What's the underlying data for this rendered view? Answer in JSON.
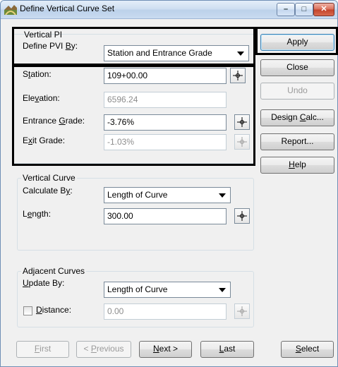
{
  "window": {
    "title": "Define Vertical Curve Set"
  },
  "vertical_pi": {
    "group_label": "Vertical PI",
    "define_by_label_pre": "Define PVI ",
    "define_by_label_ul": "B",
    "define_by_label_post": "y:",
    "define_by_value": "Station and Entrance Grade",
    "station_label_pre": "S",
    "station_label_ul": "t",
    "station_label_post": "ation:",
    "station_value": "109+00.00",
    "elevation_label_pre": "Ele",
    "elevation_label_ul": "v",
    "elevation_label_post": "ation:",
    "elevation_value": "6596.24",
    "entrance_label_pre": "Entrance ",
    "entrance_label_ul": "G",
    "entrance_label_post": "rade:",
    "entrance_value": "-3.76%",
    "exit_label_pre": "E",
    "exit_label_ul": "x",
    "exit_label_post": "it Grade:",
    "exit_value": "-1.03%"
  },
  "vertical_curve": {
    "group_label": "Vertical Curve",
    "calc_label_pre": "Calculate B",
    "calc_label_ul": "y",
    "calc_label_post": ":",
    "calc_value": "Length of Curve",
    "length_label_pre": "L",
    "length_label_ul": "e",
    "length_label_post": "ngth:",
    "length_value": "300.00"
  },
  "adjacent": {
    "group_label": "Adjacent Curves",
    "update_label_pre": "",
    "update_label_ul": "U",
    "update_label_post": "pdate By:",
    "update_value": "Length of Curve",
    "distance_label_pre": "",
    "distance_label_ul": "D",
    "distance_label_post": "istance:",
    "distance_value": "0.00"
  },
  "side_buttons": {
    "apply": "Apply",
    "close": "Close",
    "undo": "Undo",
    "design_pre": "Design ",
    "design_ul": "C",
    "design_post": "alc...",
    "report": "Report...",
    "help_pre": "",
    "help_ul": "H",
    "help_post": "elp"
  },
  "nav_buttons": {
    "first_ul": "F",
    "first_post": "irst",
    "prev_pre": "< ",
    "prev_ul": "P",
    "prev_post": "revious",
    "next_ul": "N",
    "next_post": "ext >",
    "last_ul": "L",
    "last_post": "ast",
    "select_ul": "S",
    "select_post": "elect"
  },
  "icons": {
    "app": "road-curve-icon",
    "minimize": "minimize-icon",
    "maximize": "maximize-icon",
    "close": "close-icon",
    "pick": "crosshair-icon"
  }
}
